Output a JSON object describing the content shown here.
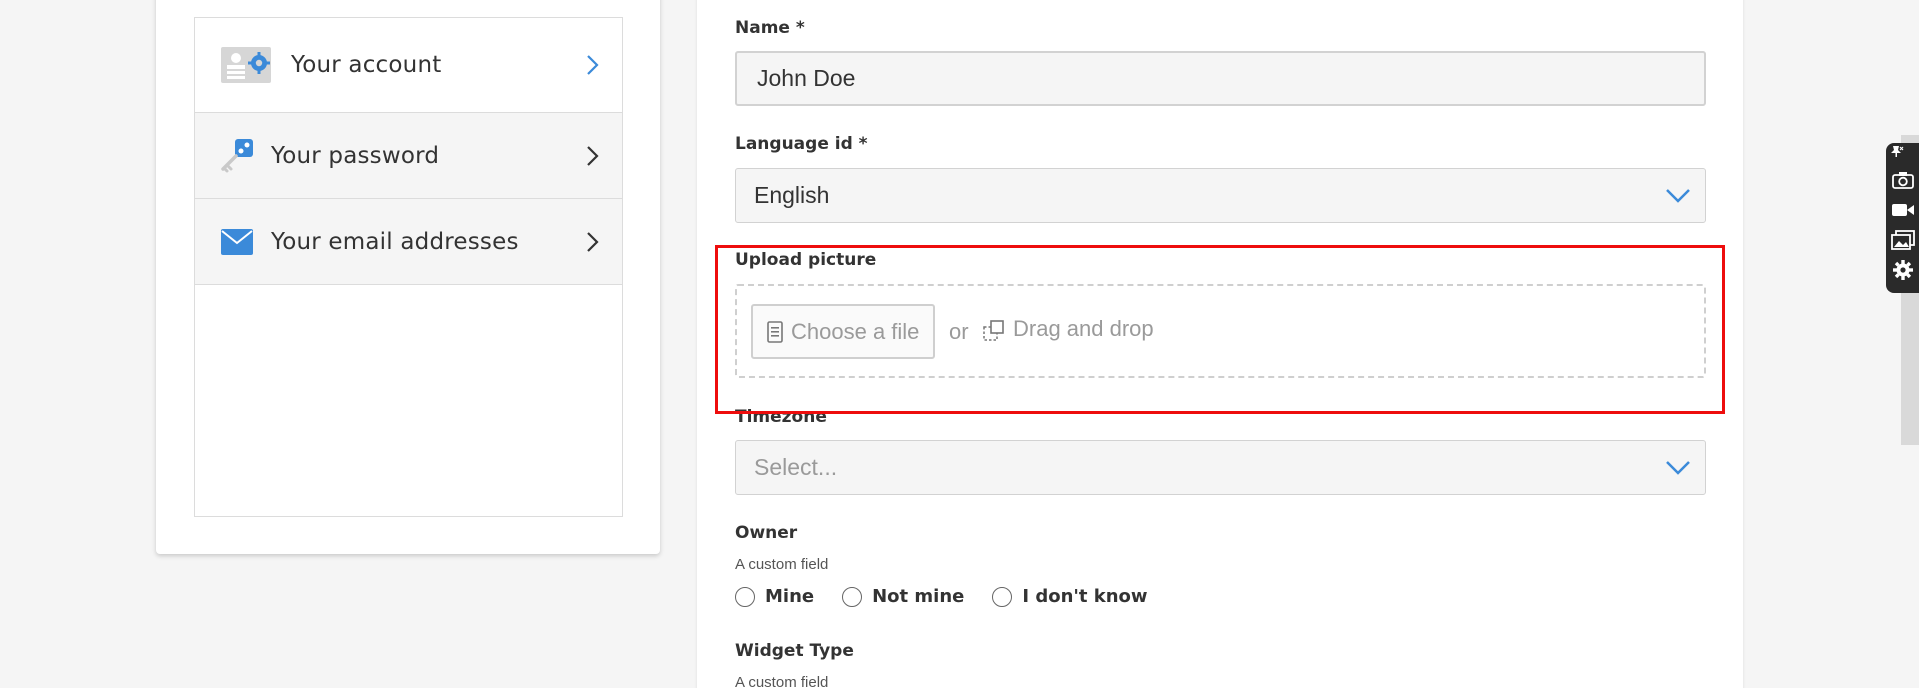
{
  "sidebar": {
    "items": [
      {
        "label": "Your account",
        "icon": "account-settings-icon"
      },
      {
        "label": "Your password",
        "icon": "key-icon"
      },
      {
        "label": "Your email addresses",
        "icon": "envelope-icon"
      }
    ]
  },
  "form": {
    "name": {
      "label": "Name *",
      "value": "John Doe"
    },
    "language": {
      "label": "Language id *",
      "value": "English"
    },
    "upload": {
      "label": "Upload picture",
      "choose_label": "Choose a file",
      "or_label": "or",
      "drag_label": "Drag and drop"
    },
    "timezone": {
      "label": "Timezone",
      "placeholder": "Select..."
    },
    "owner": {
      "label": "Owner",
      "helper": "A custom field",
      "options": [
        "Mine",
        "Not mine",
        "I don't know"
      ]
    },
    "widget_type": {
      "label": "Widget Type",
      "helper": "A custom field"
    }
  },
  "colors": {
    "accent": "#3b8ad9",
    "highlight": "#ee0d0d",
    "field_bg": "#f5f5f5"
  },
  "toolbar": {
    "icons": [
      "pin-icon",
      "camera-icon",
      "video-icon",
      "image-icon",
      "gear-icon"
    ]
  }
}
